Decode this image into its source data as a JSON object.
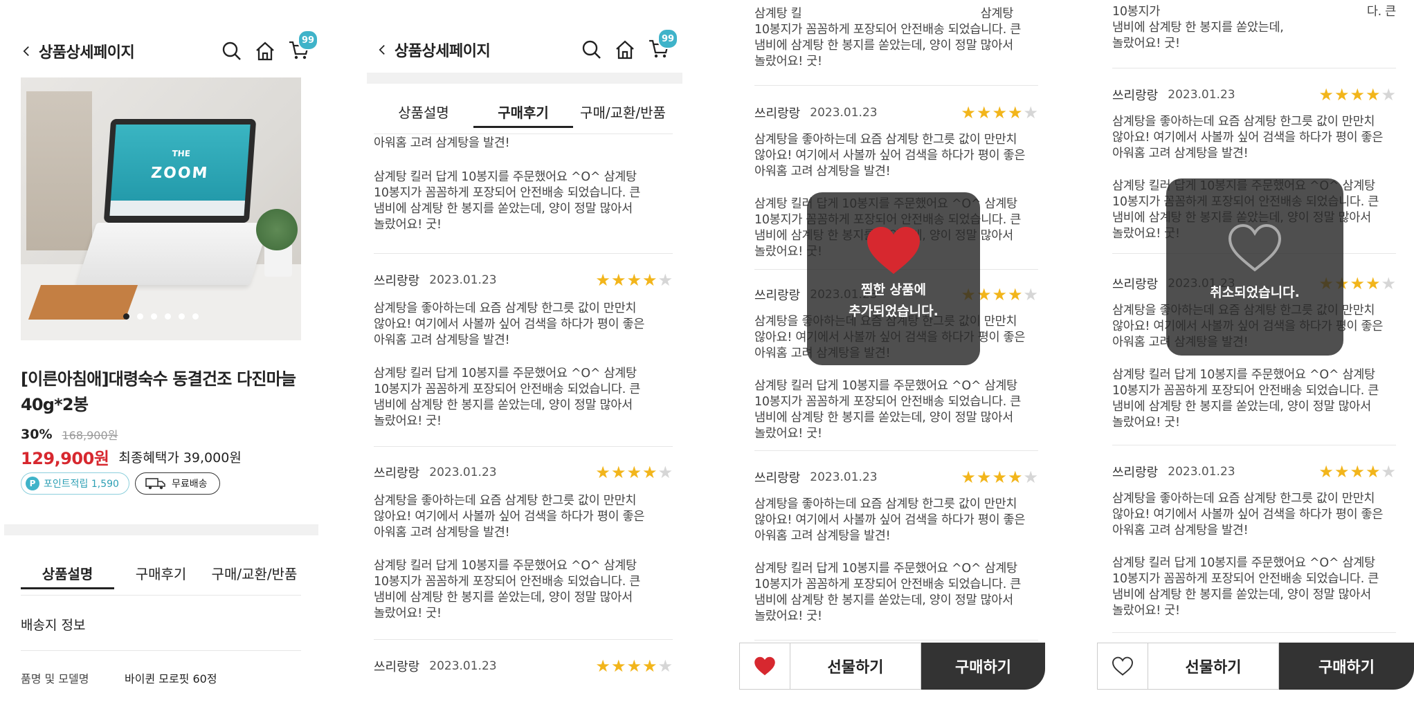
{
  "header": {
    "back_icon": "chevron-left-icon",
    "title": "상품상세페이지",
    "cart_count": "99"
  },
  "product": {
    "title": "[이른아침애]대령숙수 동결건조 다진마늘 40g*2봉",
    "title_line1": "[이른아침애]대령숙수 동결건조 다진마늘",
    "title_line2": "40g*2봉",
    "discount": "30%",
    "original_price": "168,900원",
    "price": "129,900원",
    "final_benefit": "최종혜택가 39,000원",
    "point_badge": "포인트적립 1,590",
    "point_letter": "P",
    "delivery_badge": "무료배송",
    "image_text_top": "THE",
    "image_text_main": "ZOOM",
    "carousel_dots": 6,
    "carousel_active": 1
  },
  "tabs": [
    "상품설명",
    "구매후기",
    "구매/교환/반품"
  ],
  "info": {
    "shipping_label": "배송지 정보",
    "model_label": "품명 및 모델명",
    "model_value": "바이퀸 모로핏 60정"
  },
  "review": {
    "name": "쓰리랑랑",
    "date": "2023.01.23",
    "rating": 4,
    "max_rating": 5,
    "para1": [
      "삼계탕을 좋아하는데 요즘 삼계탕 한그릇 값이 만만치",
      "않아요! 여기에서 사볼까 싶어 검색을 하다가 평이 좋은",
      "아워홈 고려 삼계탕을 발견!"
    ],
    "para2": [
      "삼계탕 킬러 답게 10봉지를 주문했어요 ^O^ 삼계탕",
      "10봉지가 꼼꼼하게 포장되어 안전배송 되었습니다. 큰",
      "냄비에 삼계탕 한 봉지를 쏟았는데, 양이 정말 많아서",
      "놀랐어요! 굿!"
    ],
    "fragment_top": "아워홈 고려 삼계탕을 발견!",
    "p3_cut_left": "삼계탕 킬",
    "p3_cut_right": "삼계탕",
    "p4_cut_left": "10봉지가",
    "p4_cut_right": "다. 큰",
    "p4_cut_line2": "냄비에 삼계탕 한 봉지를 쏟았는데,"
  },
  "toast_added": {
    "line1": "찜한 상품에",
    "line2": "추가되었습니다.",
    "icon": "heart-filled-icon"
  },
  "toast_cancel": {
    "text": "취소되었습니다.",
    "icon": "heart-outline-icon"
  },
  "bottom_bar": {
    "gift": "선물하기",
    "buy": "구매하기"
  },
  "colors": {
    "price_red": "#d7282f",
    "star": "#f2b51b",
    "badge_teal": "#3fb3c9",
    "buy_dark": "#333333",
    "heart_red": "#d7282f"
  }
}
